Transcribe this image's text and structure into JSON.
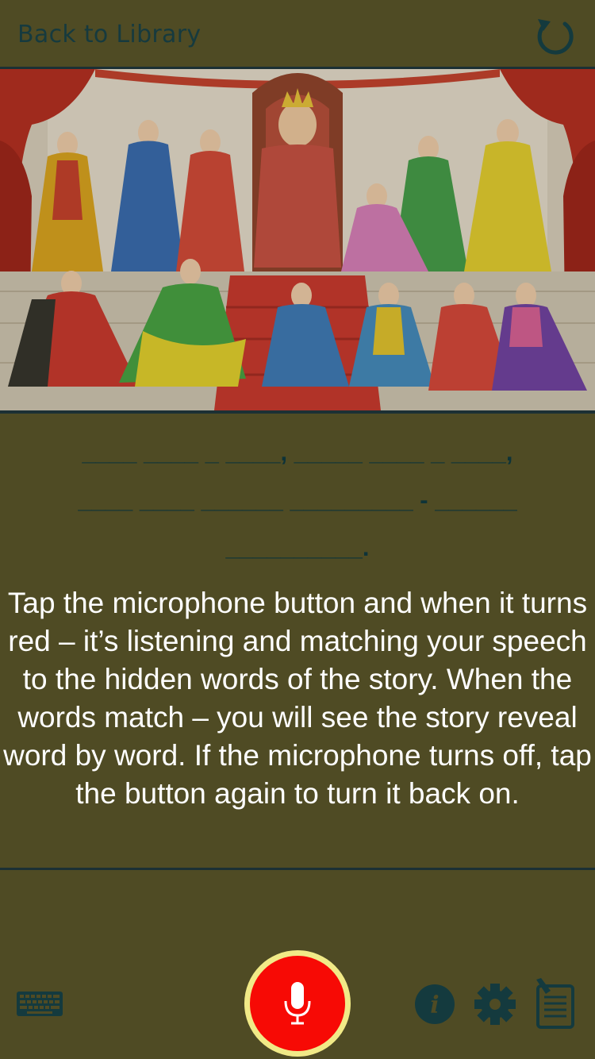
{
  "header": {
    "back_label": "Back to Library",
    "refresh_icon": "refresh-icon"
  },
  "colors": {
    "background": "#4f4b24",
    "header_text": "#163a3e",
    "mic_active": "#f70a05",
    "mic_ring": "#f1ea87",
    "icon": "#143a3e"
  },
  "story": {
    "hidden_text": "____ ____ _ ____, _____ ____ _ ____,\n____ ____ ______ _________ - ______\n__________."
  },
  "instructions": "Tap the microphone button and when it turns red – it’s listening and matching your speech to the hidden words of the story. When the words match – you will see the story reveal word by word. If the microphone turns off, tap the button again to turn it back on.",
  "toolbar": {
    "keyboard_icon": "keyboard-icon",
    "mic_icon": "microphone-icon",
    "info_icon": "info-icon",
    "settings_icon": "gear-icon",
    "notes_icon": "notes-icon"
  }
}
